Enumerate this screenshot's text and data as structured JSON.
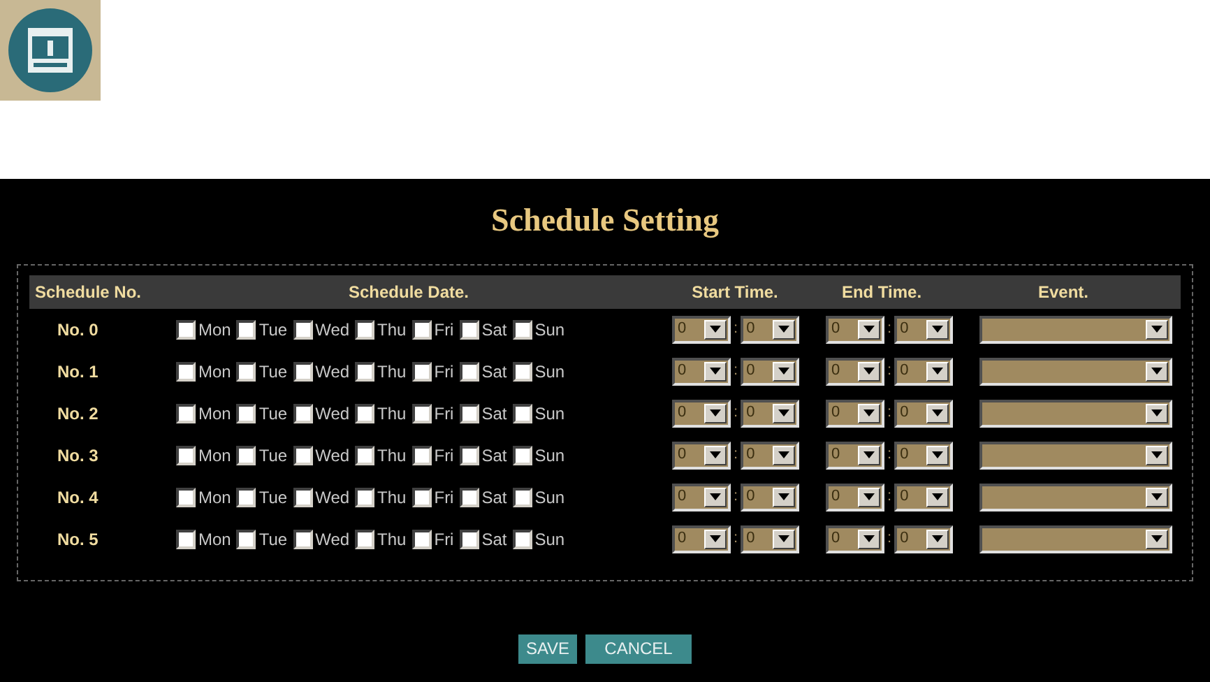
{
  "title": "Schedule Setting",
  "columns": [
    "Schedule No.",
    "Schedule Date.",
    "Start Time.",
    "End Time.",
    "Event."
  ],
  "rows": [
    {
      "name": "No. 0",
      "days": [
        {
          "label": "Mon",
          "checked": false
        },
        {
          "label": "Tue",
          "checked": false
        },
        {
          "label": "Wed",
          "checked": false
        },
        {
          "label": "Thu",
          "checked": false
        },
        {
          "label": "Fri",
          "checked": false
        },
        {
          "label": "Sat",
          "checked": false
        },
        {
          "label": "Sun",
          "checked": false
        }
      ],
      "start": {
        "hour": "0",
        "separator": ":",
        "minute": "0"
      },
      "end": {
        "hour": "0",
        "separator": ":",
        "minute": "0"
      }
    },
    {
      "name": "No. 1",
      "days": [
        {
          "label": "Mon",
          "checked": false
        },
        {
          "label": "Tue",
          "checked": false
        },
        {
          "label": "Wed",
          "checked": false
        },
        {
          "label": "Thu",
          "checked": false
        },
        {
          "label": "Fri",
          "checked": false
        },
        {
          "label": "Sat",
          "checked": false
        },
        {
          "label": "Sun",
          "checked": false
        }
      ],
      "start": {
        "hour": "0",
        "separator": ":",
        "minute": "0"
      },
      "end": {
        "hour": "0",
        "separator": ":",
        "minute": "0"
      }
    },
    {
      "name": "No. 2",
      "days": [
        {
          "label": "Mon",
          "checked": false
        },
        {
          "label": "Tue",
          "checked": false
        },
        {
          "label": "Wed",
          "checked": false
        },
        {
          "label": "Thu",
          "checked": false
        },
        {
          "label": "Fri",
          "checked": false
        },
        {
          "label": "Sat",
          "checked": false
        },
        {
          "label": "Sun",
          "checked": false
        }
      ],
      "start": {
        "hour": "0",
        "separator": ":",
        "minute": "0"
      },
      "end": {
        "hour": "0",
        "separator": ":",
        "minute": "0"
      }
    },
    {
      "name": "No. 3",
      "days": [
        {
          "label": "Mon",
          "checked": false
        },
        {
          "label": "Tue",
          "checked": false
        },
        {
          "label": "Wed",
          "checked": false
        },
        {
          "label": "Thu",
          "checked": false
        },
        {
          "label": "Fri",
          "checked": false
        },
        {
          "label": "Sat",
          "checked": false
        },
        {
          "label": "Sun",
          "checked": false
        }
      ],
      "start": {
        "hour": "0",
        "separator": ":",
        "minute": "0"
      },
      "end": {
        "hour": "0",
        "separator": ":",
        "minute": "0"
      }
    },
    {
      "name": "No. 4",
      "days": [
        {
          "label": "Mon",
          "checked": false
        },
        {
          "label": "Tue",
          "checked": false
        },
        {
          "label": "Wed",
          "checked": false
        },
        {
          "label": "Thu",
          "checked": false
        },
        {
          "label": "Fri",
          "checked": false
        },
        {
          "label": "Sat",
          "checked": false
        },
        {
          "label": "Sun",
          "checked": false
        }
      ],
      "start": {
        "hour": "0",
        "separator": ":",
        "minute": "0"
      },
      "end": {
        "hour": "0",
        "separator": ":",
        "minute": "0"
      }
    },
    {
      "name": "No. 5",
      "days": [
        {
          "label": "Mon",
          "checked": false
        },
        {
          "label": "Tue",
          "checked": false
        },
        {
          "label": "Wed",
          "checked": false
        },
        {
          "label": "Thu",
          "checked": false
        },
        {
          "label": "Fri",
          "checked": false
        },
        {
          "label": "Sat",
          "checked": false
        },
        {
          "label": "Sun",
          "checked": false
        }
      ],
      "start": {
        "hour": "0",
        "separator": ":",
        "minute": "0"
      },
      "end": {
        "hour": "0",
        "separator": ":",
        "minute": "0"
      }
    }
  ],
  "buttons": [
    "SAVE",
    "CANCEL"
  ]
}
